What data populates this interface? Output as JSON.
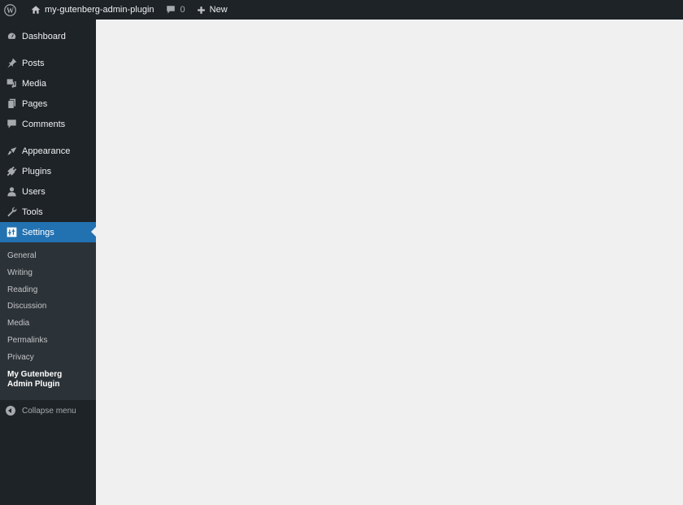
{
  "adminbar": {
    "site_name": "my-gutenberg-admin-plugin",
    "comments_count": "0",
    "new_label": "New"
  },
  "sidebar": {
    "items": [
      {
        "label": "Dashboard"
      },
      {
        "label": "Posts"
      },
      {
        "label": "Media"
      },
      {
        "label": "Pages"
      },
      {
        "label": "Comments"
      },
      {
        "label": "Appearance"
      },
      {
        "label": "Plugins"
      },
      {
        "label": "Users"
      },
      {
        "label": "Tools"
      },
      {
        "label": "Settings"
      }
    ],
    "settings_submenu": [
      {
        "label": "General"
      },
      {
        "label": "Writing"
      },
      {
        "label": "Reading"
      },
      {
        "label": "Discussion"
      },
      {
        "label": "Media"
      },
      {
        "label": "Permalinks"
      },
      {
        "label": "Privacy"
      },
      {
        "label": "My Gutenberg Admin Plugin"
      }
    ],
    "collapse_label": "Collapse menu"
  },
  "colors": {
    "adminbar_bg": "#1d2327",
    "sidebar_bg": "#1d2327",
    "submenu_bg": "#2c3338",
    "accent": "#2271b1",
    "content_bg": "#f0f0f1"
  }
}
